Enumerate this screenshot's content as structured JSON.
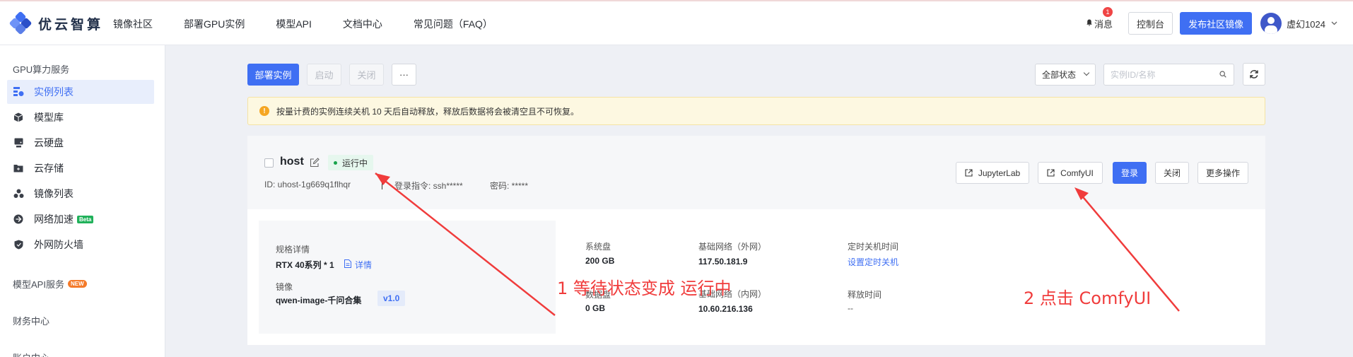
{
  "brand": {
    "name": "优云智算"
  },
  "nav": {
    "items": [
      "镜像社区",
      "部署GPU实例",
      "模型API",
      "文档中心",
      "常见问题（FAQ）"
    ]
  },
  "header": {
    "messages_label": "消息",
    "messages_badge": "1",
    "console_label": "控制台",
    "publish_label": "发布社区镜像",
    "username": "虚幻1024"
  },
  "sidebar": {
    "group_gpu": "GPU算力服务",
    "items": [
      {
        "label": "实例列表",
        "icon": "instance-list-icon",
        "active": true
      },
      {
        "label": "模型库",
        "icon": "model-cube-icon"
      },
      {
        "label": "云硬盘",
        "icon": "disk-icon"
      },
      {
        "label": "云存储",
        "icon": "folder-icon"
      },
      {
        "label": "镜像列表",
        "icon": "image-stack-icon"
      },
      {
        "label": "网络加速",
        "icon": "network-speed-icon",
        "badge": "Beta"
      },
      {
        "label": "外网防火墙",
        "icon": "shield-icon"
      }
    ],
    "group_api": "模型API服务",
    "group_api_badge": "NEW",
    "group_finance": "财务中心",
    "group_account": "账户中心"
  },
  "toolbar": {
    "deploy_label": "部署实例",
    "start_label": "启动",
    "stop_label": "关闭",
    "more_label": "···",
    "status_filter": "全部状态",
    "search_placeholder": "实例ID/名称"
  },
  "notice": {
    "text": "按量计费的实例连续关机 10 天后自动释放，释放后数据将会被清空且不可恢复。"
  },
  "instance": {
    "name": "host",
    "status": "运行中",
    "id_text": "ID: uhost-1g669q1flhqr",
    "login_text": "登录指令: ssh*****",
    "password_text": "密码: *****",
    "actions": {
      "jupyter": "JupyterLab",
      "comfyui": "ComfyUI",
      "login": "登录",
      "close": "关闭",
      "more": "更多操作"
    },
    "spec_label": "规格详情",
    "spec_value": "RTX 40系列 * 1",
    "spec_detail_link": "详情",
    "image_label": "镜像",
    "image_value": "qwen-image-千问合集",
    "image_version": "v1.0",
    "system_disk_label": "系统盘",
    "system_disk_value": "200 GB",
    "data_disk_label": "数据盘",
    "data_disk_value": "0 GB",
    "public_net_label": "基础网络（外网）",
    "public_net_value": "117.50.181.9",
    "private_net_label": "基础网络（内网）",
    "private_net_value": "10.60.216.136",
    "schedule_label": "定时关机时间",
    "schedule_link": "设置定时关机",
    "release_label": "释放时间",
    "release_value": "--"
  },
  "annotations": {
    "step1": "1 等待状态变成 运行中",
    "step2": "2 点击 ComfyUI",
    "color": "#f03c3c"
  }
}
